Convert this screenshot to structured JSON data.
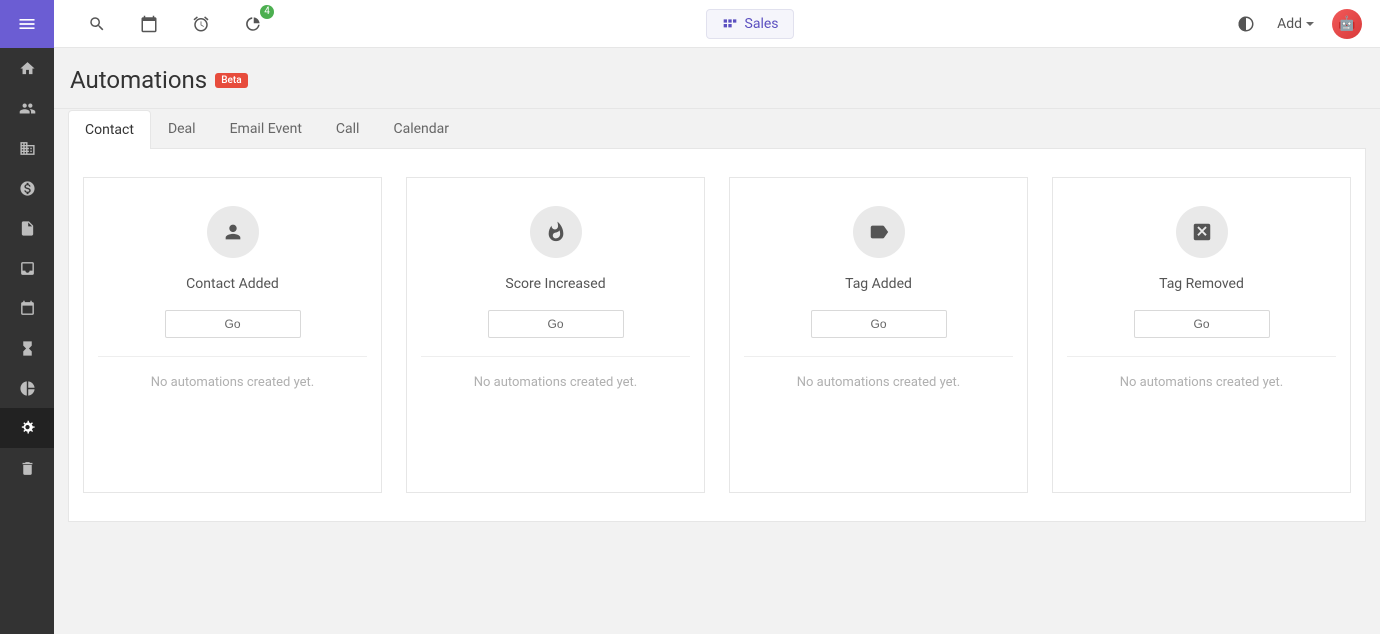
{
  "header": {
    "sales_label": "Sales",
    "add_label": "Add",
    "notification_count": "4"
  },
  "page": {
    "title": "Automations",
    "badge": "Beta"
  },
  "tabs": [
    {
      "label": "Contact",
      "active": true
    },
    {
      "label": "Deal",
      "active": false
    },
    {
      "label": "Email Event",
      "active": false
    },
    {
      "label": "Call",
      "active": false
    },
    {
      "label": "Calendar",
      "active": false
    }
  ],
  "cards": [
    {
      "icon": "person",
      "title": "Contact Added",
      "button": "Go",
      "empty": "No automations created yet."
    },
    {
      "icon": "fire",
      "title": "Score Increased",
      "button": "Go",
      "empty": "No automations created yet."
    },
    {
      "icon": "tag",
      "title": "Tag Added",
      "button": "Go",
      "empty": "No automations created yet."
    },
    {
      "icon": "cancel",
      "title": "Tag Removed",
      "button": "Go",
      "empty": "No automations created yet."
    }
  ],
  "sidebar": {
    "items": [
      {
        "name": "home"
      },
      {
        "name": "people"
      },
      {
        "name": "company"
      },
      {
        "name": "deals"
      },
      {
        "name": "documents"
      },
      {
        "name": "inbox"
      },
      {
        "name": "calendar"
      },
      {
        "name": "hourglass"
      },
      {
        "name": "reports"
      },
      {
        "name": "automations"
      },
      {
        "name": "trash"
      }
    ]
  }
}
